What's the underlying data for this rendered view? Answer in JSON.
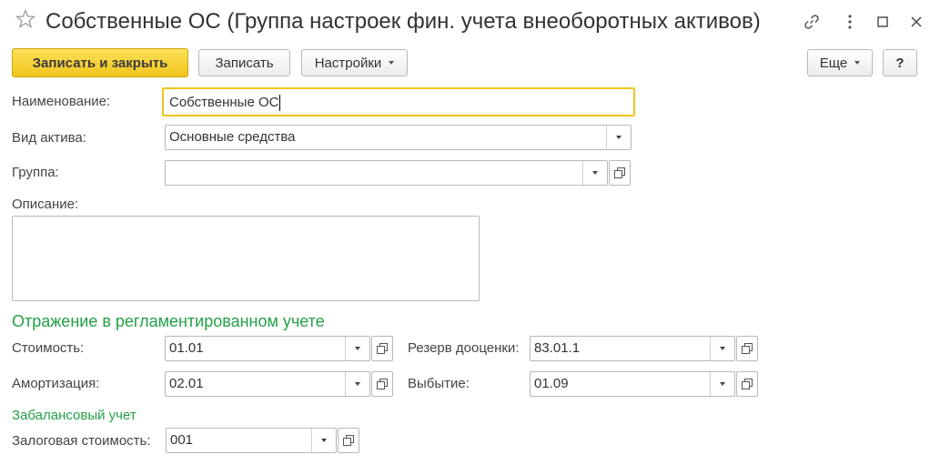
{
  "window": {
    "title": "Собственные ОС (Группа настроек фин. учета внеоборотных активов)"
  },
  "toolbar": {
    "save_close_label": "Записать и закрыть",
    "save_label": "Записать",
    "settings_label": "Настройки",
    "more_label": "Еще",
    "help_label": "?"
  },
  "form": {
    "name_label": "Наименование:",
    "name_value": "Собственные ОС",
    "asset_type_label": "Вид актива:",
    "asset_type_value": "Основные средства",
    "group_label": "Группа:",
    "group_value": "",
    "description_label": "Описание:",
    "description_value": ""
  },
  "regulated": {
    "section_title": "Отражение в регламентированном учете",
    "cost_label": "Стоимость:",
    "cost_value": "01.01",
    "depreciation_label": "Амортизация:",
    "depreciation_value": "02.01",
    "revaluation_label": "Резерв дооценки:",
    "revaluation_value": "83.01.1",
    "disposal_label": "Выбытие:",
    "disposal_value": "01.09"
  },
  "offbalance": {
    "section_title": "Забалансовый учет",
    "pledge_label": "Залоговая стоимость:",
    "pledge_value": "001"
  },
  "colors": {
    "accent": "#f2c51c",
    "section_green": "#23a046"
  }
}
